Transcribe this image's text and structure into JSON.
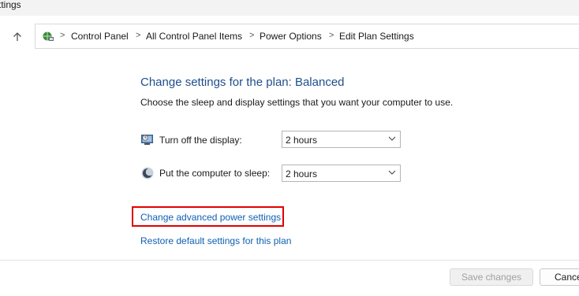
{
  "window": {
    "title": "ttings"
  },
  "nav": {
    "up_icon": "arrow-up-icon",
    "address_icon": "control-panel-icon",
    "breadcrumbs": [
      "Control Panel",
      "All Control Panel Items",
      "Power Options",
      "Edit Plan Settings"
    ],
    "separator": ">"
  },
  "main": {
    "heading": "Change settings for the plan: Balanced",
    "description": "Choose the sleep and display settings that you want your computer to use.",
    "display_row": {
      "label": "Turn off the display:",
      "value": "2 hours",
      "icon": "monitor-clock-icon"
    },
    "sleep_row": {
      "label": "Put the computer to sleep:",
      "value": "2 hours",
      "icon": "moon-icon"
    },
    "advanced_link": "Change advanced power settings",
    "restore_link": "Restore default settings for this plan"
  },
  "footer": {
    "save_label": "Save changes",
    "cancel_label": "Cance"
  },
  "colors": {
    "heading": "#1e4e8c",
    "link": "#0f5fb4",
    "highlight": "#e00000"
  }
}
